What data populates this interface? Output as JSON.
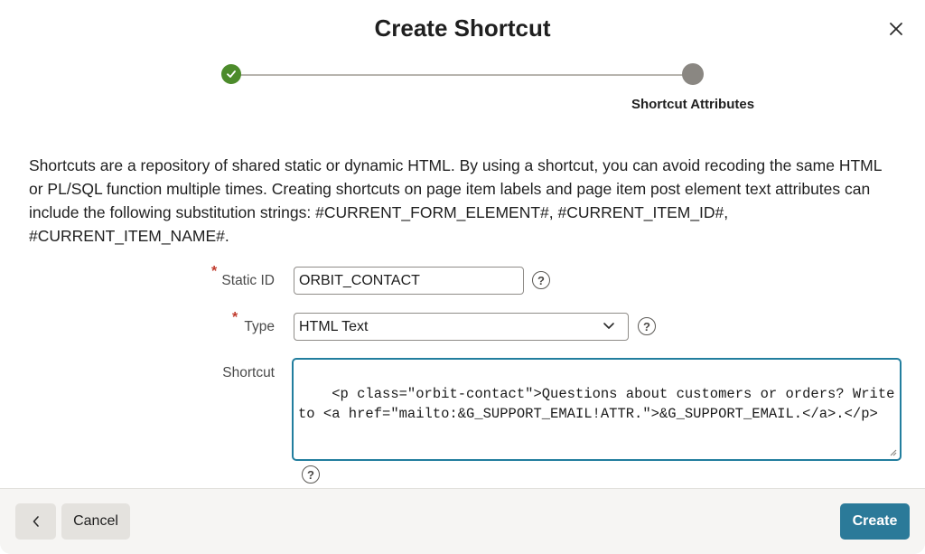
{
  "dialog": {
    "title": "Create Shortcut",
    "close_icon": "close-icon"
  },
  "wizard": {
    "steps": [
      {
        "state": "completed",
        "icon": "check-icon"
      },
      {
        "state": "current",
        "label": "Shortcut Attributes"
      }
    ]
  },
  "description": "Shortcuts are a repository of shared static or dynamic HTML. By using a shortcut, you can avoid recoding the same HTML or PL/SQL function multiple times. Creating shortcuts on page item labels and page item post element text attributes can include the following substitution strings: #CURRENT_FORM_ELEMENT#, #CURRENT_ITEM_ID#, #CURRENT_ITEM_NAME#.",
  "form": {
    "static_id": {
      "label": "Static ID",
      "required": true,
      "value": "ORBIT_CONTACT",
      "help": "?"
    },
    "type": {
      "label": "Type",
      "required": true,
      "value": "HTML Text",
      "help": "?"
    },
    "shortcut": {
      "label": "Shortcut",
      "value": "<p class=\"orbit-contact\">Questions about customers or orders? Write to <a href=\"mailto:&G_SUPPORT_EMAIL!ATTR.\">&G_SUPPORT_EMAIL.</a>.</p>",
      "help": "?"
    }
  },
  "footer": {
    "back_icon": "chevron-left-icon",
    "cancel_label": "Cancel",
    "create_label": "Create"
  },
  "colors": {
    "accent": "#2b7a99",
    "success": "#4c8b2b",
    "required": "#c0392b"
  }
}
